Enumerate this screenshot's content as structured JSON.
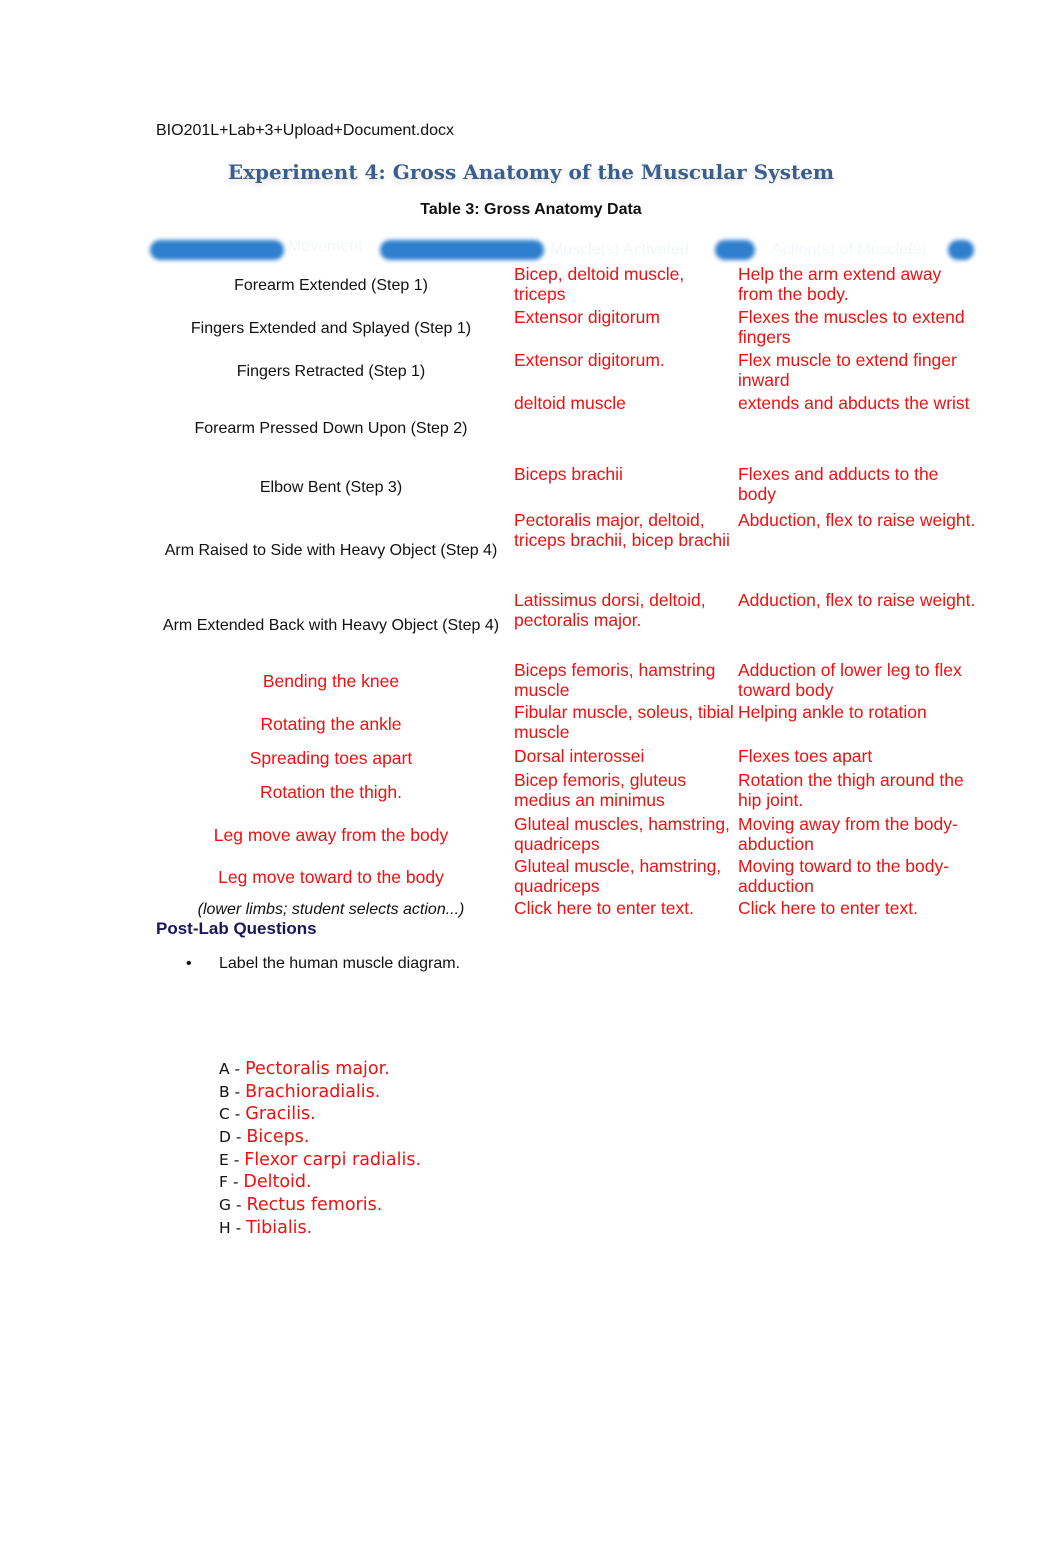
{
  "document": {
    "filename": "BIO201L+Lab+3+Upload+Document.docx",
    "title": "Experiment 4: Gross Anatomy of the Muscular System",
    "table_caption": "Table 3: Gross Anatomy Data"
  },
  "table": {
    "headers": [
      "Movement",
      "Muscle(s) Activated",
      "Action(s) of Muscle(s)"
    ],
    "header_color": "#2e7fce",
    "rows": [
      {
        "movement": "Forearm Extended (Step 1)",
        "muscles": "Bicep, deltoid muscle, triceps",
        "action": "Help the arm  extend away from the body."
      },
      {
        "movement": "Fingers Extended and Splayed (Step 1)",
        "muscles": "Extensor digitorum",
        "action": "Flexes the muscles to extend fingers"
      },
      {
        "movement": "Fingers Retracted (Step 1)",
        "muscles": "Extensor digitorum.",
        "action": "Flex muscle to extend finger inward"
      },
      {
        "movement": "Forearm Pressed Down Upon (Step 2)",
        "muscles": "deltoid muscle",
        "action": "extends and abducts the wrist"
      },
      {
        "movement": "Elbow Bent (Step 3)",
        "muscles": "Biceps brachii",
        "action": "Flexes and adducts to the body"
      },
      {
        "movement": "Arm Raised to Side with Heavy Object (Step 4)",
        "muscles": " Pectoralis major, deltoid, triceps brachii, bicep brachii",
        "action": "Abduction, flex to raise weight."
      },
      {
        "movement": "Arm Extended Back with Heavy Object (Step 4)",
        "muscles": "Latissimus dorsi, deltoid, pectoralis major.",
        "action": "Adduction, flex to raise weight."
      },
      {
        "movement": "Bending the knee",
        "muscles": "Biceps femoris, hamstring muscle",
        "action": "Adduction of lower leg to flex toward body"
      },
      {
        "movement": "Rotating the ankle",
        "muscles": "Fibular muscle, soleus, tibial muscle",
        "action": "Helping ankle to rotation"
      },
      {
        "movement": "Spreading toes apart",
        "muscles": "Dorsal interossei",
        "action": "Flexes toes apart"
      },
      {
        "movement": "Rotation the thigh.",
        "muscles": "Bicep femoris, gluteus medius an minimus",
        "action": "Rotation the thigh around the hip joint."
      },
      {
        "movement": "Leg move away from the body",
        "muscles": "Gluteal muscles, hamstring, quadriceps",
        "action": "Moving away from the body- abduction"
      },
      {
        "movement": "Leg move toward to the body",
        "muscles": "Gluteal muscle, hamstring, quadriceps",
        "action": "Moving toward to the body-adduction"
      },
      {
        "movement": "(lower limbs; student selects action...)",
        "muscles": "Click here to enter text.",
        "action": "Click here to enter text."
      }
    ]
  },
  "post_lab": {
    "heading": "Post-Lab Questions",
    "bullet": "Label the human muscle diagram.",
    "labels": [
      {
        "letter": "A - ",
        "answer": "Pectoralis major."
      },
      {
        "letter": "B - ",
        "answer": "Brachioradialis."
      },
      {
        "letter": "C - ",
        "answer": "Gracilis."
      },
      {
        "letter": "D - ",
        "answer": "Biceps."
      },
      {
        "letter": "E - ",
        "answer": "Flexor carpi radialis."
      },
      {
        "letter": "F - ",
        "answer": "Deltoid."
      },
      {
        "letter": "G - ",
        "answer": "Rectus femoris."
      },
      {
        "letter": "H - ",
        "answer": "Tibialis."
      }
    ]
  },
  "colors": {
    "answer_red": "#ee1111",
    "title_blue": "#3a5f8f",
    "heading_navy": "#17175a"
  }
}
